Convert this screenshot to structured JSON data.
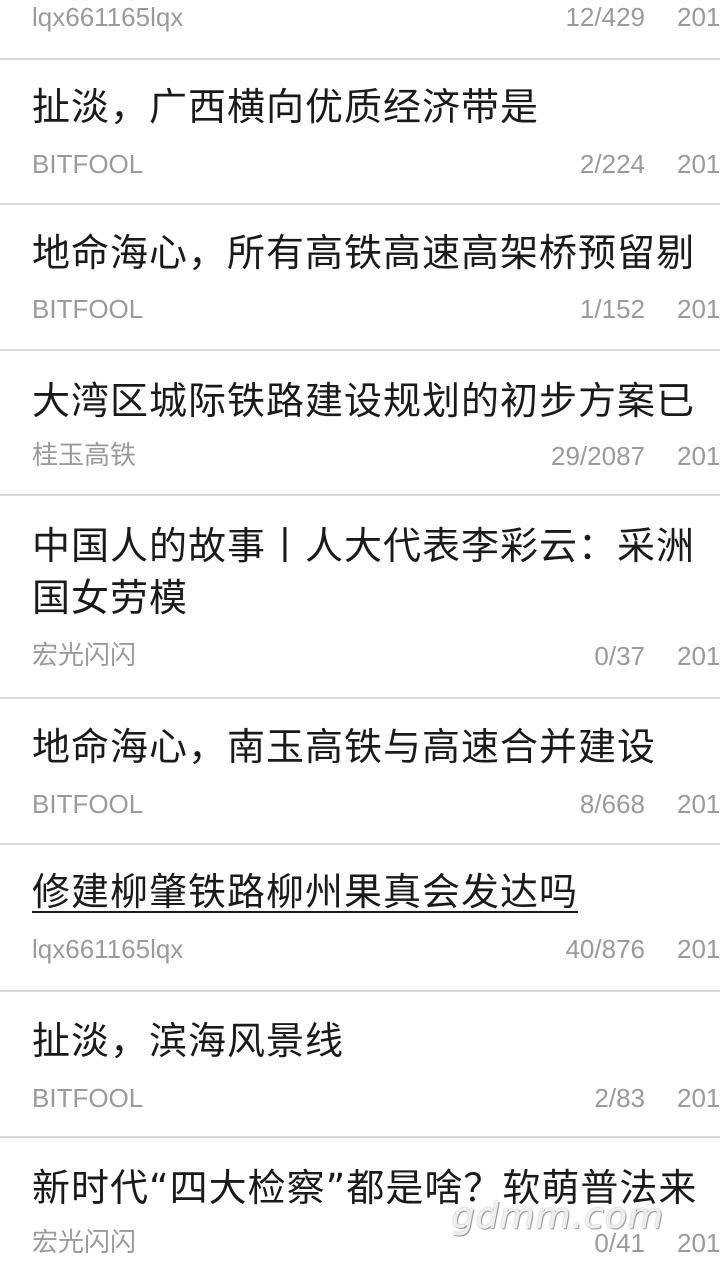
{
  "posts": [
    {
      "title": "",
      "author": "lqx661165lqx",
      "stats": "12/429",
      "date": "201"
    },
    {
      "title": "扯淡，广西横向优质经济带是",
      "author": "BITFOOL",
      "stats": "2/224",
      "date": "201"
    },
    {
      "title": "地命海心，所有高铁高速高架桥预留剔",
      "author": "BITFOOL",
      "stats": "1/152",
      "date": "201"
    },
    {
      "title": "大湾区城际铁路建设规划的初步方案已",
      "author": "桂玉高铁",
      "stats": "29/2087",
      "date": "201"
    },
    {
      "title": "中国人的故事丨人大代表李彩云：采洲",
      "title2": "国女劳模",
      "author": "宏光闪闪",
      "stats": "0/37",
      "date": "201"
    },
    {
      "title": "地命海心，南玉高铁与高速合并建设",
      "author": "BITFOOL",
      "stats": "8/668",
      "date": "201"
    },
    {
      "title": "修建柳肇铁路柳州果真会发达吗",
      "author": "lqx661165lqx",
      "stats": "40/876",
      "date": "201"
    },
    {
      "title": "扯淡，滨海风景线",
      "author": "BITFOOL",
      "stats": "2/83",
      "date": "201"
    },
    {
      "title": "新时代“四大检察”都是啥？软萌普法来",
      "author": "宏光闪闪",
      "stats": "0/41",
      "date": "201"
    }
  ],
  "watermark": "gdmm.com"
}
